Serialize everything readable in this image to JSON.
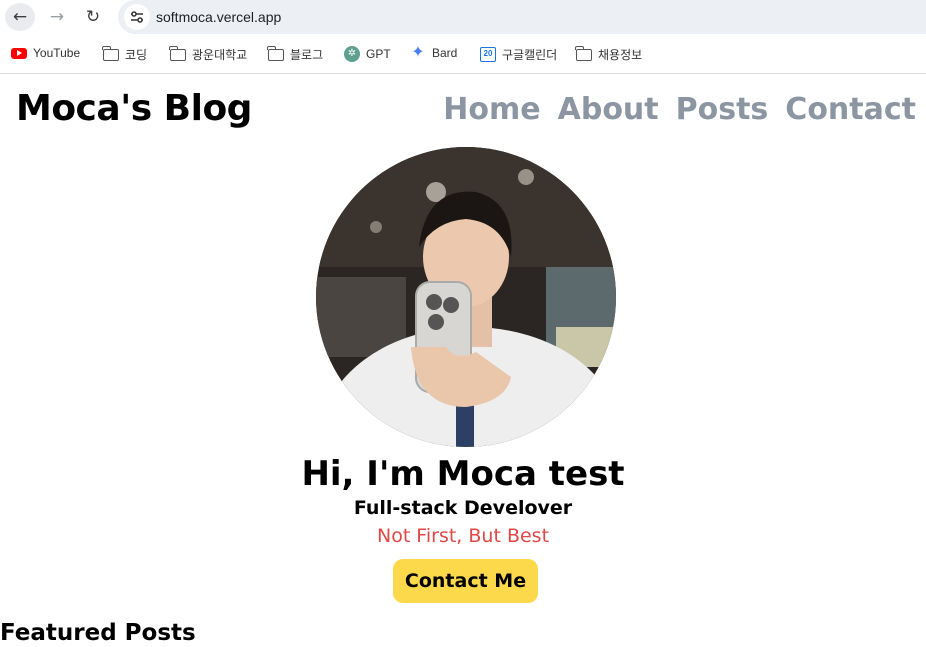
{
  "browser": {
    "url": "softmoca.vercel.app",
    "bookmarks": [
      {
        "label": "YouTube",
        "icon": "youtube-icon"
      },
      {
        "label": "코딩",
        "icon": "folder-icon"
      },
      {
        "label": "광운대학교",
        "icon": "folder-icon"
      },
      {
        "label": "블로그",
        "icon": "folder-icon"
      },
      {
        "label": "GPT",
        "icon": "chatgpt-icon"
      },
      {
        "label": "Bard",
        "icon": "bard-sparkle-icon"
      },
      {
        "label": "구글캘린더",
        "icon": "google-calendar-icon"
      },
      {
        "label": "채용정보",
        "icon": "folder-icon"
      }
    ],
    "calendar_icon_text": "20"
  },
  "site": {
    "brand": "Moca's Blog",
    "nav": [
      "Home",
      "About",
      "Posts",
      "Contact"
    ]
  },
  "hero": {
    "title": "Hi, I'm Moca test",
    "subtitle": "Full-stack Develover",
    "motto": "Not First, But Best",
    "cta": "Contact Me"
  },
  "sections": {
    "featured_title": "Featured Posts"
  },
  "colors": {
    "nav_link": "#8c95a2",
    "motto": "#e04848",
    "cta_background": "#fcd94a"
  }
}
